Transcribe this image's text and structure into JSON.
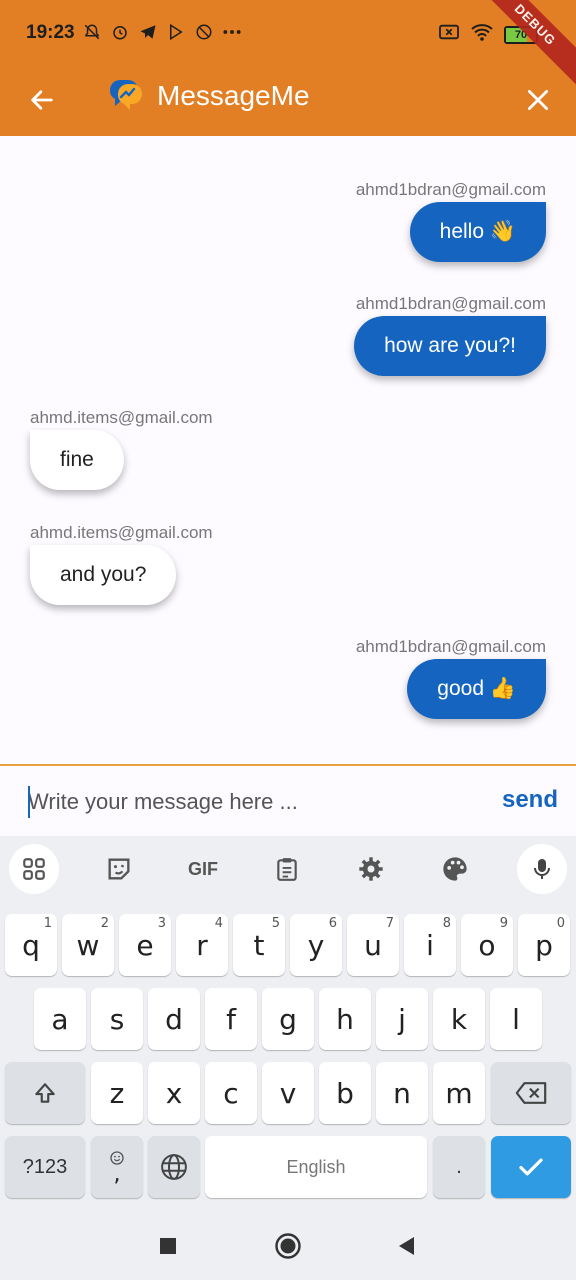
{
  "status_bar": {
    "time": "19:23",
    "battery_level": "70",
    "notification_icons": [
      "mute-icon",
      "alarm-icon",
      "telegram-icon",
      "play-store-icon",
      "blocked-icon",
      "more-dots-icon"
    ],
    "system_icons": [
      "no-sim-icon",
      "wifi-icon",
      "battery-icon"
    ]
  },
  "debug_banner": "DEBUG",
  "app_bar": {
    "title": "MessageMe",
    "background": "#E27F25"
  },
  "messages": [
    {
      "sender": "ahmd1bdran@gmail.com",
      "text": "hello 👋",
      "is_me": true
    },
    {
      "sender": "ahmd1bdran@gmail.com",
      "text": "how are you?!",
      "is_me": true
    },
    {
      "sender": "ahmd.items@gmail.com",
      "text": "fine",
      "is_me": false
    },
    {
      "sender": "ahmd.items@gmail.com",
      "text": "and you?",
      "is_me": false
    },
    {
      "sender": "ahmd1bdran@gmail.com",
      "text": "good 👍",
      "is_me": true
    }
  ],
  "composer": {
    "placeholder": "Write your message here ...",
    "value": "",
    "send_label": "send"
  },
  "keyboard": {
    "toolbar": {
      "gif_label": "GIF"
    },
    "rows": {
      "row1": [
        "q",
        "w",
        "e",
        "r",
        "t",
        "y",
        "u",
        "i",
        "o",
        "p"
      ],
      "row1_hints": [
        "1",
        "2",
        "3",
        "4",
        "5",
        "6",
        "7",
        "8",
        "9",
        "0"
      ],
      "row2": [
        "a",
        "s",
        "d",
        "f",
        "g",
        "h",
        "j",
        "k",
        "l"
      ],
      "row3": [
        "z",
        "x",
        "c",
        "v",
        "b",
        "n",
        "m"
      ]
    },
    "symbols_label": "?123",
    "comma_label": ",",
    "space_label": "English",
    "period_label": "."
  },
  "colors": {
    "accent": "#E27F25",
    "my_bubble": "#1565C0",
    "their_bubble": "#FFFFFF",
    "send": "#1565C0"
  }
}
